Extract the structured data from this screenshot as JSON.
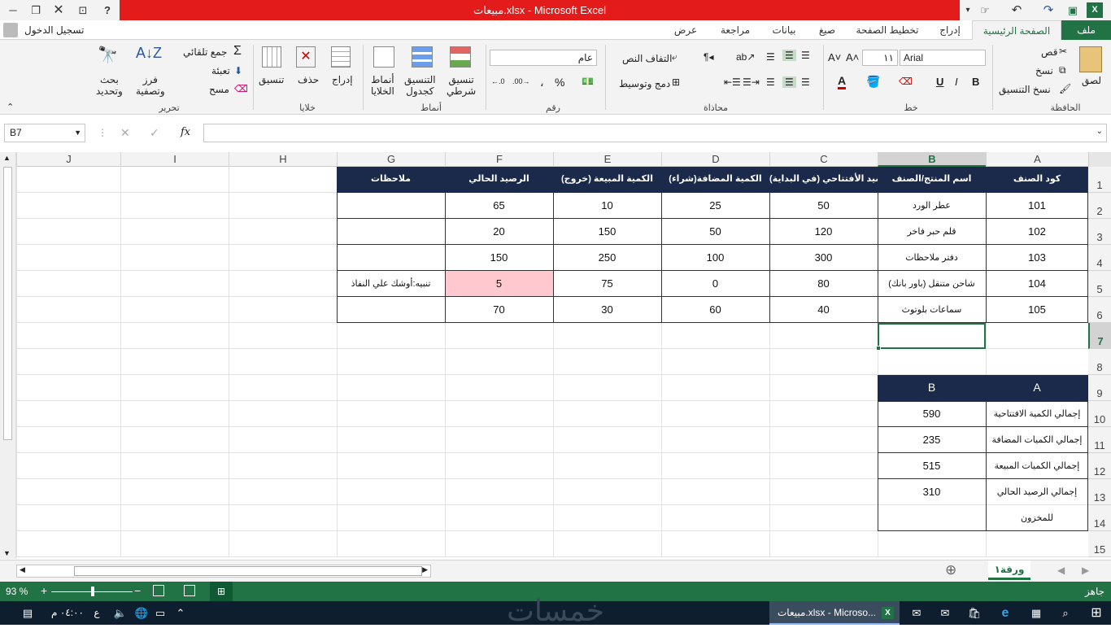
{
  "window": {
    "title": "مبيعات.xlsx - Microsoft Excel",
    "signin": "تسجيل الدخول"
  },
  "tabs": [
    "ملف",
    "الصفحة الرئيسية",
    "إدراج",
    "تخطيط الصفحة",
    "صيغ",
    "بيانات",
    "مراجعة",
    "عرض"
  ],
  "ribbon": {
    "clipboard": {
      "paste": "لصق",
      "cut": "قص",
      "copy": "نسخ",
      "format_painter": "نسخ التنسيق",
      "label": "الحافظة"
    },
    "font": {
      "name": "Arial",
      "size": "١١",
      "label": "خط"
    },
    "alignment": {
      "wrap": "التفاف النص",
      "merge": "دمج وتوسيط",
      "label": "محاذاة"
    },
    "number": {
      "format": "عام",
      "label": "رقم"
    },
    "styles": {
      "conditional": "تنسيق شرطي",
      "table": "التنسيق كجدول",
      "cell": "أنماط الخلايا",
      "label": "أنماط"
    },
    "cells": {
      "insert": "إدراج",
      "delete": "حذف",
      "format": "تنسيق",
      "label": "خلايا"
    },
    "editing": {
      "autosum": "جمع تلقائي",
      "fill": "تعبئة",
      "clear": "مسح",
      "sort": "فرز وتصفية",
      "find": "بحث وتحديد",
      "label": "تحرير"
    }
  },
  "formula_bar": {
    "name_box": "B7",
    "fx": "fx",
    "value": ""
  },
  "columns": [
    "A",
    "B",
    "C",
    "D",
    "E",
    "F",
    "G",
    "H",
    "I",
    "J"
  ],
  "rows": [
    "1",
    "2",
    "3",
    "4",
    "5",
    "6",
    "7",
    "8",
    "9",
    "10",
    "11",
    "12",
    "13",
    "14",
    "15"
  ],
  "table": {
    "headers": [
      "كود الصنف",
      "اسم المنتج/الصنف",
      "الرصيد الأفتتاحي (في البداية)",
      "الكمية المضافة(شراء)",
      "الكمية المبيعة (خروج)",
      "الرصيد الحالي",
      "ملاحظات"
    ],
    "rows": [
      [
        "101",
        "عطر الورد",
        "50",
        "25",
        "10",
        "65",
        ""
      ],
      [
        "102",
        "قلم حبر فاخر",
        "120",
        "50",
        "150",
        "20",
        ""
      ],
      [
        "103",
        "دفتر ملاحظات",
        "300",
        "100",
        "250",
        "150",
        ""
      ],
      [
        "104",
        "شاحن متنقل (باور بانك)",
        "80",
        "0",
        "75",
        "5",
        "تنبيه:أوشك علي النفاذ"
      ],
      [
        "105",
        "سماعات بلوتوث",
        "40",
        "60",
        "30",
        "70",
        ""
      ]
    ]
  },
  "summary": {
    "headers": [
      "A",
      "B"
    ],
    "rows": [
      [
        "إجمالي الكمية الافتتاحية",
        "590"
      ],
      [
        "إجمالي الكميات المضافة",
        "235"
      ],
      [
        "إجمالي الكميات المبيعة",
        "515"
      ],
      [
        "إجمالي الرصيد الحالي",
        "310"
      ],
      [
        "للمخزون",
        ""
      ]
    ]
  },
  "sheet": {
    "tab": "ورقة١"
  },
  "status": {
    "ready": "جاهز",
    "zoom": "93 %"
  },
  "taskbar": {
    "app": "مبيعات.xlsx - Microso...",
    "time": "٠٤:٠٠ م",
    "lang": "ع",
    "watermark": "خمسات"
  },
  "colors": {
    "excel_green": "#217346",
    "header_navy": "#1b2a4a",
    "alert_pink": "#ffc7ce",
    "title_red": "#e41b1b"
  }
}
